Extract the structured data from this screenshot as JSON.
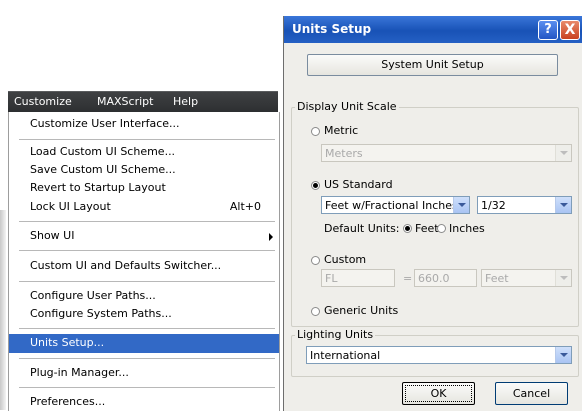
{
  "menubar": {
    "items": [
      "Customize",
      "MAXScript",
      "Help"
    ]
  },
  "menu": {
    "items": [
      {
        "label": "Customize User Interface...",
        "shortcut": ""
      },
      {
        "label": "Load Custom UI Scheme...",
        "shortcut": ""
      },
      {
        "label": "Save Custom UI Scheme...",
        "shortcut": ""
      },
      {
        "label": "Revert to Startup Layout",
        "shortcut": ""
      },
      {
        "label": "Lock UI Layout",
        "shortcut": "Alt+0"
      },
      {
        "label": "Show UI",
        "shortcut": ""
      },
      {
        "label": "Custom UI and Defaults Switcher...",
        "shortcut": ""
      },
      {
        "label": "Configure User Paths...",
        "shortcut": ""
      },
      {
        "label": "Configure System Paths...",
        "shortcut": ""
      },
      {
        "label": "Units Setup...",
        "shortcut": ""
      },
      {
        "label": "Plug-in Manager...",
        "shortcut": ""
      },
      {
        "label": "Preferences...",
        "shortcut": ""
      }
    ],
    "selected_item": "Units Setup..."
  },
  "dialog": {
    "title": "Units Setup",
    "help_glyph": "?",
    "close_glyph": "X",
    "system_unit_setup": "System Unit Setup",
    "display_unit_scale": {
      "legend": "Display Unit Scale",
      "metric": {
        "label": "Metric",
        "value": "Meters"
      },
      "us_standard": {
        "label": "US Standard",
        "unit_value": "Feet w/Fractional Inches",
        "fraction_value": "1/32",
        "default_units_label": "Default Units:",
        "feet_label": "Feet",
        "inches_label": "Inches"
      },
      "custom": {
        "label": "Custom",
        "name_value": "FL",
        "equals": "=",
        "amount_value": "660.0",
        "unit_value": "Feet"
      },
      "generic": {
        "label": "Generic Units"
      },
      "selected": "US Standard",
      "default_units_selected": "Feet"
    },
    "lighting_units": {
      "legend": "Lighting Units",
      "value": "International"
    },
    "ok_label": "OK",
    "cancel_label": "Cancel"
  }
}
